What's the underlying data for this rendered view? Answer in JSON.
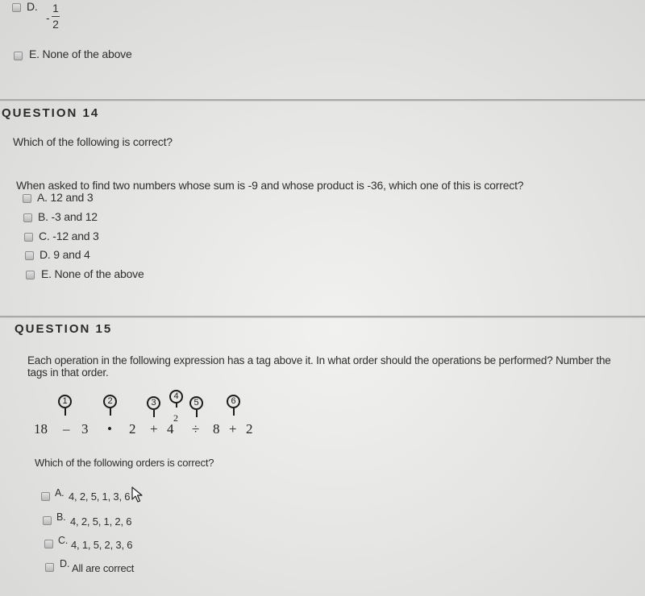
{
  "question13_tail": {
    "options": [
      {
        "letter": "D.",
        "fraction": {
          "sign": "-",
          "numerator": "1",
          "denominator": "2"
        }
      },
      {
        "letter": "E.",
        "text": "E. None of the above"
      }
    ]
  },
  "question14": {
    "heading": "QUESTION 14",
    "prompt": "Which of the following is correct?",
    "body": "When asked to find two numbers whose sum is -9 and whose product is -36, which one of this is correct?",
    "options": [
      {
        "label": "A. 12 and 3"
      },
      {
        "label": "B. -3 and 12"
      },
      {
        "label": "C. -12 and 3"
      },
      {
        "label": "D. 9 and 4"
      },
      {
        "label": "E. None of the above"
      }
    ]
  },
  "question15": {
    "heading": "QUESTION 15",
    "body_line1": "Each operation in the following expression has a tag above it. In what order should the operations be performed? Number the",
    "body_line2": "tags in that order.",
    "expression": {
      "tokens": [
        "18",
        "–",
        "3",
        "•",
        "2",
        "+",
        "4",
        "2",
        "÷",
        "8",
        "+",
        "2"
      ],
      "tags": [
        "1",
        "2",
        "3",
        "4",
        "5",
        "6"
      ]
    },
    "sub_prompt": "Which of the following orders is correct?",
    "options": [
      {
        "letter": "A.",
        "text": "4, 2, 5, 1, 3, 6"
      },
      {
        "letter": "B.",
        "text": "4, 2, 5, 1, 2, 6"
      },
      {
        "letter": "C.",
        "text": "4, 1, 5, 2, 3, 6"
      },
      {
        "letter": "D.",
        "text": "All are correct"
      }
    ]
  },
  "icons": {
    "checkbox": "checkbox-unchecked",
    "cursor": "mouse-pointer-arrow"
  }
}
